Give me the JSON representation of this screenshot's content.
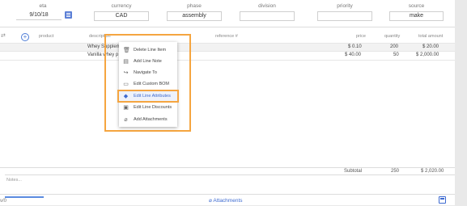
{
  "header": {
    "eta_label": "eta",
    "eta_value": "9/10/18",
    "currency_label": "currency",
    "currency_value": "CAD",
    "phase_label": "phase",
    "phase_value": "assembly",
    "division_label": "division",
    "division_value": "",
    "priority_label": "priority",
    "priority_value": "",
    "source_label": "source",
    "source_value": "make"
  },
  "table": {
    "columns": {
      "product": "product",
      "description": "description",
      "reference": "reference #",
      "price": "price",
      "quantity": "quantity",
      "total_amount": "total amount"
    },
    "rows": [
      {
        "description": "Whey Supplem",
        "price": "$ 0.10",
        "quantity": "200",
        "total": "$ 20.00"
      },
      {
        "description": "Vanilla whey p",
        "price": "$ 40.00",
        "quantity": "50",
        "total": "$ 2,000.00"
      }
    ]
  },
  "context_menu": {
    "items": [
      {
        "label": "Delete Line Item",
        "icon": "trash-icon"
      },
      {
        "label": "Add Line Note",
        "icon": "note-icon"
      },
      {
        "label": "Navigate To",
        "icon": "share-arrow-icon"
      },
      {
        "label": "Edit Custom BOM",
        "icon": "monitor-icon"
      },
      {
        "label": "Edit Line Attributes",
        "icon": "tag-icon"
      },
      {
        "label": "Edit Line Discounts",
        "icon": "gift-icon"
      },
      {
        "label": "Add Attachments",
        "icon": "paperclip-icon"
      }
    ],
    "selected_index": 4
  },
  "footer": {
    "subtotal_label": "Subtotal",
    "subtotal_quantity": "250",
    "subtotal_amount": "$ 2,020.00",
    "notes_placeholder": "Notes...",
    "attachments_label": "Attachments",
    "left_edge_text": "v/0"
  },
  "colors": {
    "accent": "#3d6ad0",
    "highlight": "#f5a540"
  }
}
